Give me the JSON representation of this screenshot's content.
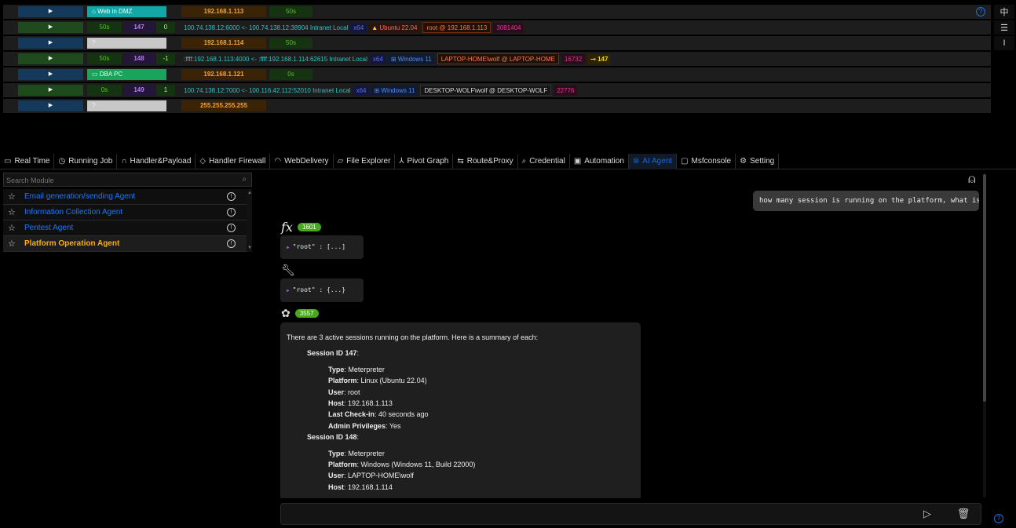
{
  "hosts": [
    {
      "tag": "Web in DMZ",
      "ip": "192.168.1.113",
      "ttl": "50s"
    },
    {
      "tag": "?",
      "ip": "192.168.1.114",
      "ttl": "50s"
    },
    {
      "tag": "DBA PC",
      "ip": "192.168.1.121",
      "ttl": "0s"
    },
    {
      "tag": "?",
      "ip": "255.255.255.255",
      "ttl": ""
    }
  ],
  "sessions": [
    {
      "time": "50s",
      "id": "147",
      "int": "0",
      "conn": "100.74.138.12:6000 <- 100.74.138.12:38904 Intranet Local",
      "arch": "x64",
      "os": "Ubuntu 22.04",
      "user": "root @ 192.168.1.113",
      "pid": "3081404",
      "link": ""
    },
    {
      "time": "50s",
      "id": "148",
      "int": "-1",
      "conn": ":ffff:192.168.1.113:4000 <- :ffff:192.168.1.114:62615 Intranet Local",
      "arch": "x64",
      "os": "Windows 11",
      "user": "LAPTOP-HOME\\wolf @ LAPTOP-HOME",
      "pid": "16732",
      "link": "147"
    },
    {
      "time": "0s",
      "id": "149",
      "int": "1",
      "conn": "100.74.138.12:7000 <- 100.116.42.112:52010 Intranet Local",
      "arch": "x64",
      "os": "Windows 11",
      "user": "DESKTOP-WOLF\\wolf @ DESKTOP-WOLF",
      "pid": "22776",
      "link": ""
    }
  ],
  "right_tools": {
    "lang": "中",
    "list": "☰",
    "cursor": "I"
  },
  "tabs": [
    {
      "icon": "▭",
      "label": "Real Time"
    },
    {
      "icon": "◷",
      "label": "Running Job"
    },
    {
      "icon": "∩",
      "label": "Handler&Payload"
    },
    {
      "icon": "◇",
      "label": "Handler Firewall"
    },
    {
      "icon": "◠",
      "label": "WebDelivery"
    },
    {
      "icon": "▱",
      "label": "File Explorer"
    },
    {
      "icon": "⅄",
      "label": "Pivot Graph"
    },
    {
      "icon": "⇆",
      "label": "Route&Proxy"
    },
    {
      "icon": "⌕",
      "label": "Credential"
    },
    {
      "icon": "▣",
      "label": "Automation"
    },
    {
      "icon": "⊛",
      "label": "AI Agent"
    },
    {
      "icon": "▢",
      "label": "Msfconsole"
    },
    {
      "icon": "⚙",
      "label": "Setting"
    }
  ],
  "search": {
    "placeholder": "Search Module"
  },
  "modules": [
    {
      "label": "Email generation/sending Agent"
    },
    {
      "label": "Information Collection Agent"
    },
    {
      "label": "Pentest Agent"
    },
    {
      "label": "Platform Operation Agent"
    }
  ],
  "chat": {
    "user_message": "how many session is running on the platform, what is",
    "fx_badge": "1601",
    "json_1": "\"root\" : [...]",
    "json_2": "\"root\" : {...}",
    "gpt_badge": "3557",
    "assistant": {
      "intro": "There are 3 active sessions running on the platform. Here is a summary of each:",
      "s147_title": "Session ID 147",
      "s147": [
        {
          "k": "Type",
          "v": ": Meterpreter"
        },
        {
          "k": "Platform",
          "v": ": Linux (Ubuntu 22.04)"
        },
        {
          "k": "User",
          "v": ": root"
        },
        {
          "k": "Host",
          "v": ": 192.168.1.113"
        },
        {
          "k": "Last Check-in",
          "v": ": 40 seconds ago"
        },
        {
          "k": "Admin Privileges",
          "v": ": Yes"
        }
      ],
      "s148_title": "Session ID 148",
      "s148": [
        {
          "k": "Type",
          "v": ": Meterpreter"
        },
        {
          "k": "Platform",
          "v": ": Windows (Windows 11, Build 22000)"
        },
        {
          "k": "User",
          "v": ": LAPTOP-HOME\\wolf"
        },
        {
          "k": "Host",
          "v": ": 192.168.1.114"
        }
      ]
    },
    "input_placeholder": ""
  },
  "colors": {
    "accent": "#1668dc",
    "active_module": "#faad14",
    "badge": "#49aa19"
  }
}
